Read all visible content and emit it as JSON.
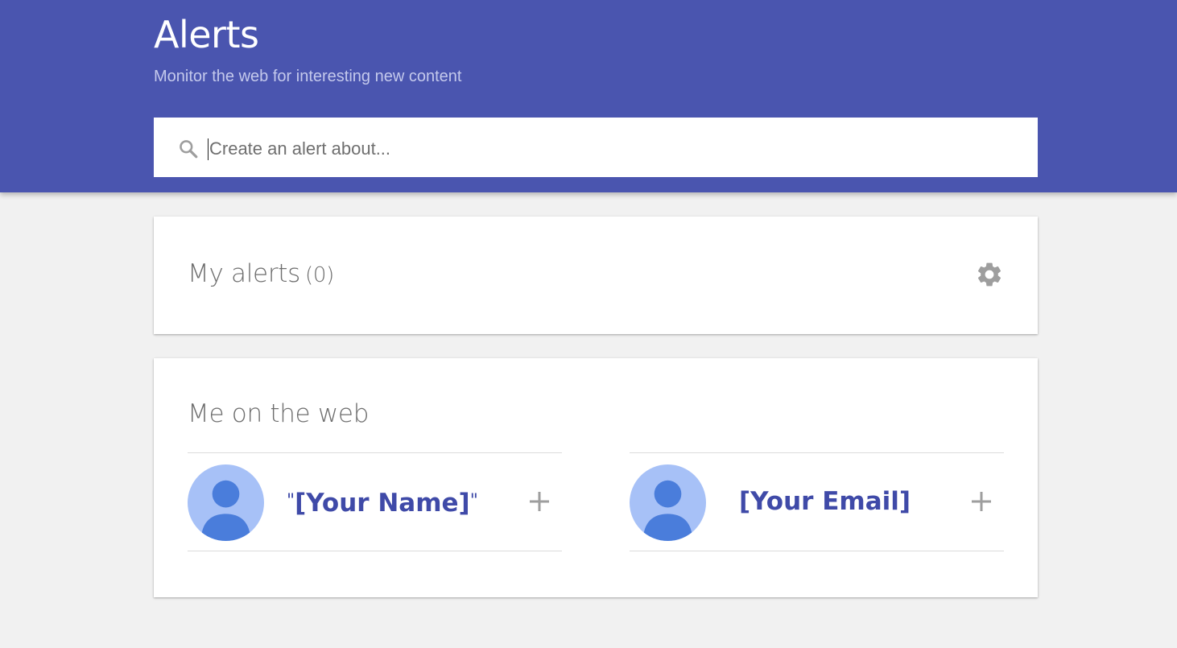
{
  "header": {
    "title": "Alerts",
    "subtitle": "Monitor the web for interesting new content",
    "background_color": "#4a55af"
  },
  "search": {
    "placeholder": "Create an alert about...",
    "value": "",
    "icon": "search-icon"
  },
  "my_alerts": {
    "title": "My alerts",
    "count": "(0)",
    "settings_icon": "gear-icon"
  },
  "me_on_web": {
    "title": "Me on the web",
    "suggestions": [
      {
        "label": "[Your Name]",
        "open_quote": "\"",
        "close_quote": "\"",
        "avatar_icon": "person-avatar-icon",
        "add_icon": "plus-icon"
      },
      {
        "label": "[Your Email]",
        "avatar_icon": "person-avatar-icon",
        "add_icon": "plus-icon"
      }
    ]
  },
  "colors": {
    "accent": "#4a55af",
    "label_blue": "#3f4aa8",
    "avatar_light": "#a7c1f7",
    "avatar_dark": "#4a7ddb",
    "page_background": "#f1f1f1"
  }
}
